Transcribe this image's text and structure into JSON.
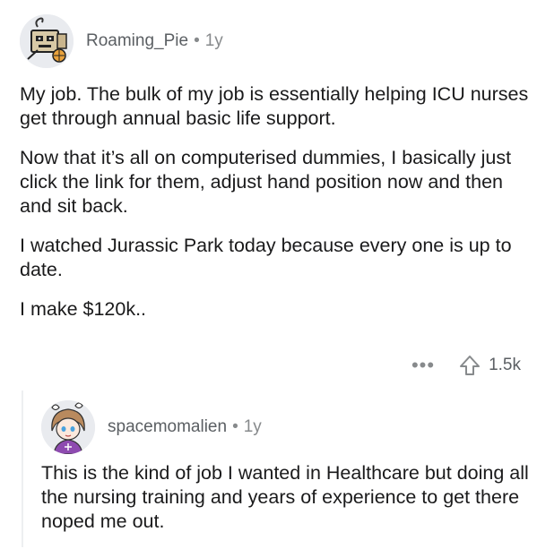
{
  "top_comment": {
    "username": "Roaming_Pie",
    "separator": "•",
    "age": "1y",
    "paragraphs": [
      "My job. The bulk of my job is essentially helping ICU nurses get through annual basic life support.",
      "Now that it’s all on computerised dummies, I basically just click the link for them, adjust hand position now and then and sit back.",
      "I watched Jurassic Park today because every one is up to date.",
      "I make $120k.."
    ],
    "more_label": "•••",
    "upvote_icon": "upvote-arrow-icon",
    "score": "1.5k"
  },
  "reply": {
    "username": "spacemomalien",
    "separator": "•",
    "age": "1y",
    "paragraphs": [
      "This is the kind of job I wanted in Healthcare but doing all the nursing training and years of experience to get there noped me out."
    ]
  },
  "colors": {
    "text": "#1a1a1b",
    "meta": "#878a8c",
    "avatar_bg": "#e9ebef",
    "thread_line": "#edeff1"
  }
}
